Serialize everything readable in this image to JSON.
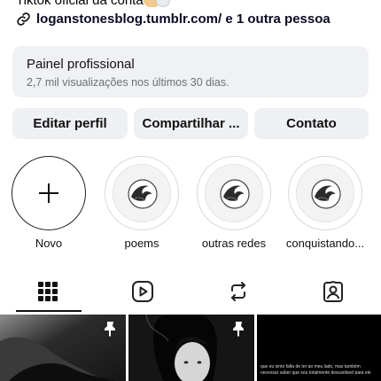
{
  "profile": {
    "bio_line": "Tiktok oficial da conta",
    "link_text": "loganstonesblog.tumblr.com/ e 1 outra pessoa"
  },
  "dashboard": {
    "title": "Painel profissional",
    "subtitle": "2,7 mil visualizações nos últimos 30 dias."
  },
  "buttons": {
    "edit": "Editar perfil",
    "share": "Compartilhar ...",
    "contact": "Contato"
  },
  "highlights": [
    {
      "label": "Novo"
    },
    {
      "label": "poems"
    },
    {
      "label": "outras redes"
    },
    {
      "label": "conquistando..."
    }
  ],
  "tabs": [
    "posts-grid-icon",
    "reels-icon",
    "reposts-icon",
    "tagged-icon"
  ],
  "posts": {
    "third_caption": "que eu sinto falta de ter ao meu lado, mas também\nnecessar saber que sou totalmente descartável para ele"
  }
}
